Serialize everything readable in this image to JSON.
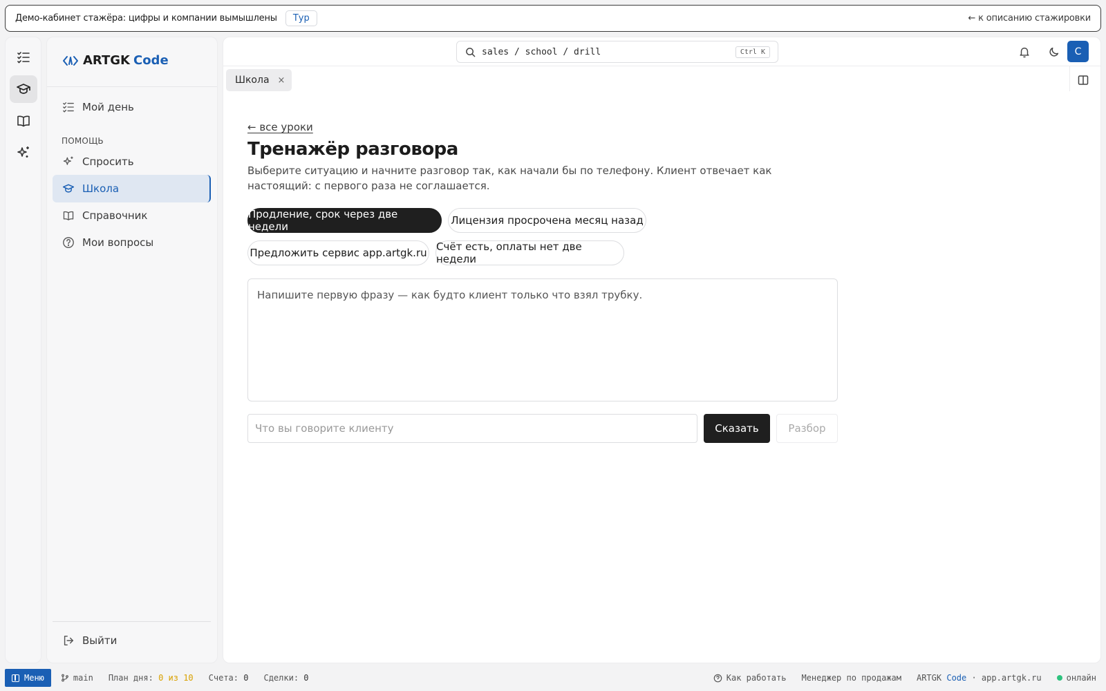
{
  "banner": {
    "text": "Демо-кабинет стажёра: цифры и компании вымышлены",
    "tour_label": "Тур",
    "back_link": "← к описанию стажировки"
  },
  "brand": {
    "name": "ARTGK",
    "accent": "Code",
    "accent_color": "#1a5fb4"
  },
  "sidebar": {
    "items": [
      {
        "label": "Мой день",
        "icon": "checklist-icon"
      },
      {
        "label": "Спросить",
        "icon": "sparkles-icon"
      },
      {
        "label": "Школа",
        "icon": "graduation-cap-icon",
        "active": true
      },
      {
        "label": "Справочник",
        "icon": "book-icon"
      },
      {
        "label": "Мои вопросы",
        "icon": "help-circle-icon"
      }
    ],
    "section_help": "ПОМОЩЬ",
    "logout_label": "Выйти"
  },
  "topbar": {
    "search_path": "sales / school / drill",
    "shortcut": "Ctrl K",
    "avatar_initial": "С"
  },
  "tabs": [
    {
      "label": "Школа",
      "close": "×"
    }
  ],
  "page": {
    "back_link": "← все уроки",
    "title": "Тренажёр разговора",
    "description": "Выберите ситуацию и начните разговор так, как начали бы по телефону. Клиент отвечает как настоящий: с первого раза не соглашается.",
    "scenarios": [
      {
        "label": "Продление, срок через две недели",
        "selected": true
      },
      {
        "label": "Лицензия просрочена месяц назад",
        "selected": false
      },
      {
        "label": "Предложить сервис app.artgk.ru",
        "selected": false
      },
      {
        "label": "Счёт есть, оплаты нет две недели",
        "selected": false
      }
    ],
    "chat_placeholder": "Напишите первую фразу — как будто клиент только что взял трубку.",
    "input_placeholder": "Что вы говорите клиенту",
    "say_label": "Сказать",
    "review_label": "Разбор"
  },
  "statusbar": {
    "menu_label": "Меню",
    "branch": "main",
    "plan_label": "План дня:",
    "plan_value": "0 из 10",
    "invoices_label": "Счета:",
    "invoices_value": "0",
    "deals_label": "Сделки:",
    "deals_value": "0",
    "how_label": "Как работать",
    "role": "Менеджер по продажам",
    "brand_name": "ARTGK",
    "brand_accent": "Code",
    "domain": "· app.artgk.ru",
    "online": "онлайн"
  }
}
